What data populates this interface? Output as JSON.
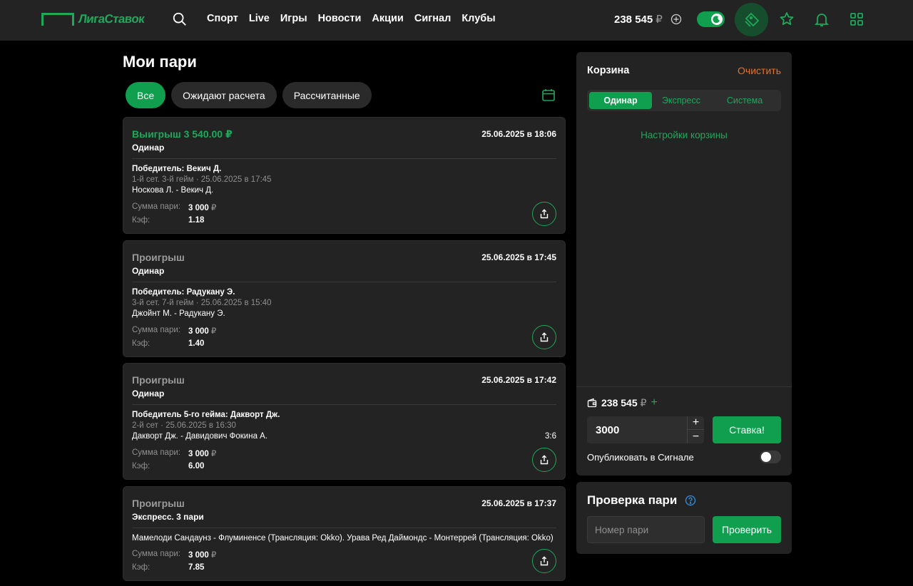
{
  "header": {
    "logo_text": "ЛигаСтавок",
    "nav": [
      "Спорт",
      "Live",
      "Игры",
      "Новости",
      "Акции",
      "Сигнал",
      "Клубы"
    ],
    "balance": "238 545",
    "currency": "₽"
  },
  "page": {
    "title": "Мои пари",
    "filters": [
      "Все",
      "Ожидают расчета",
      "Рассчитанные"
    ],
    "active_filter": 0
  },
  "bets": [
    {
      "status": "Выигрыш 3 540.00 ₽",
      "win": true,
      "date": "25.06.2025 в 18:06",
      "type": "Одинар",
      "selection": "Победитель: Векич Д.",
      "meta": "1-й сет. 3-й гейм · 25.06.2025 в 17:45",
      "match": "Носкова Л. - Векич Д.",
      "score": "",
      "stake_label": "Сумма пари:",
      "stake": "3 000",
      "odds_label": "Кэф:",
      "odds": "1.18"
    },
    {
      "status": "Проигрыш",
      "win": false,
      "date": "25.06.2025 в 17:45",
      "type": "Одинар",
      "selection": "Победитель: Радукану Э.",
      "meta": "3-й сет. 7-й гейм · 25.06.2025 в 15:40",
      "match": "Джойнт М. - Радукану Э.",
      "score": "",
      "stake_label": "Сумма пари:",
      "stake": "3 000",
      "odds_label": "Кэф:",
      "odds": "1.40"
    },
    {
      "status": "Проигрыш",
      "win": false,
      "date": "25.06.2025 в 17:42",
      "type": "Одинар",
      "selection": "Победитель 5-го гейма: Дакворт Дж.",
      "meta": "2-й сет · 25.06.2025 в 16:30",
      "match": "Дакворт Дж. - Давидович Фокина А.",
      "score": "3:6",
      "stake_label": "Сумма пари:",
      "stake": "3 000",
      "odds_label": "Кэф:",
      "odds": "6.00"
    },
    {
      "status": "Проигрыш",
      "win": false,
      "date": "25.06.2025 в 17:37",
      "type": "Экспресс. 3 пари",
      "long_match": "Мамелоди Сандаунз - Флуминенсе (Трансляция: Okko). Урава Ред Даймондс - Монтеррей (Трансляция: Okko)",
      "stake_label": "Сумма пари:",
      "stake": "3 000",
      "odds_label": "Кэф:",
      "odds": "7.85"
    }
  ],
  "cart": {
    "title": "Корзина",
    "clear": "Очистить",
    "tabs": [
      "Одинар",
      "Экспресс",
      "Система"
    ],
    "active_tab": 0,
    "settings": "Настройки корзины",
    "balance": "238 545",
    "amount": "3000",
    "stake_button": "Ставка!",
    "publish_label": "Опубликовать в Сигнале",
    "publish_on": false
  },
  "check": {
    "title": "Проверка пари",
    "placeholder": "Номер пари",
    "button": "Проверить"
  },
  "colors": {
    "accent": "#0f9f4e",
    "accent_text": "#1ea85a",
    "clear": "#e8702a",
    "panel": "#232323",
    "background": "#000000"
  }
}
